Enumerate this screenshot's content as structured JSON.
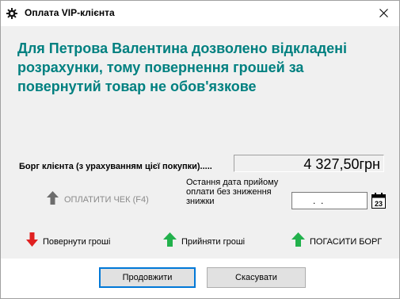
{
  "window": {
    "title": "Оплата VIP-клієнта"
  },
  "message": {
    "line1": "Для Петрова Валентина дозволено відкладені",
    "line2": "розрахунки, тому повернення грошей за",
    "line3": "повернутий товар не обов'язкове"
  },
  "debt": {
    "label": "Борг клієнта (з урахуванням цієї покупки).....",
    "value": "4 327,50грн"
  },
  "pay_check": {
    "label": "ОПЛАТИТИ ЧЕК (F4)",
    "enabled": false
  },
  "last_payment": {
    "label_line1": "Остання дата прийому",
    "label_line2": "оплати без зниження",
    "label_line3": "знижки",
    "date_value": ".  .",
    "calendar_day": "23"
  },
  "actions": {
    "return_money": "Повернути гроші",
    "accept_money": "Прийняти гроші",
    "pay_debt": "ПОГАСИТИ БОРГ"
  },
  "buttons": {
    "continue": "Продовжити",
    "cancel": "Скасувати"
  },
  "colors": {
    "message": "#008080",
    "arrow_red": "#e02020",
    "arrow_green": "#22b14c",
    "arrow_disabled": "#6d6d6d",
    "primary_border": "#0078d7"
  },
  "icons": {
    "title": "gear-icon",
    "close": "close-icon",
    "pay_check": "arrow-up-icon",
    "return_money": "arrow-down-icon",
    "accept_money": "arrow-up-icon",
    "pay_debt": "arrow-up-icon",
    "calendar": "calendar-icon"
  }
}
